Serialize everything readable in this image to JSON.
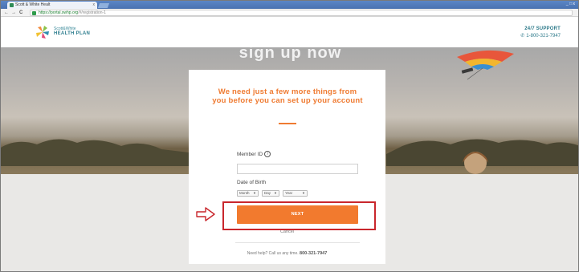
{
  "browser": {
    "tab_title": "Scott & White Healt",
    "tab_close": "x",
    "window_controls": "_ □ x",
    "back": "←",
    "forward": "→",
    "reload": "C",
    "url_host": "https://portal.swhp.org",
    "url_path": "/#/registration-1"
  },
  "header": {
    "logo_small": "Scott&White",
    "logo_big": "HEALTH PLAN",
    "support_title": "24/7 SUPPORT",
    "support_phone": "1-800-321-7947",
    "phone_icon": "phone-icon"
  },
  "hero": {
    "title": "sign up now"
  },
  "form": {
    "heading": "We need just a few more things from you before you can set up your account",
    "member_id_label": "Member ID",
    "info_glyph": "i",
    "member_id_value": "",
    "dob_label": "Date of Birth",
    "month_select": "Month",
    "day_select": "Day",
    "year_select": "Year",
    "next_label": "NEXT",
    "cancel_label": "Cancel",
    "help_text": "Need help? Call us any time.",
    "help_phone": "800-321-7947"
  },
  "colors": {
    "accent": "#f27a2e",
    "heading": "#ef7b32",
    "brand_teal": "#2d7a8a",
    "annotation": "#c9262c"
  }
}
